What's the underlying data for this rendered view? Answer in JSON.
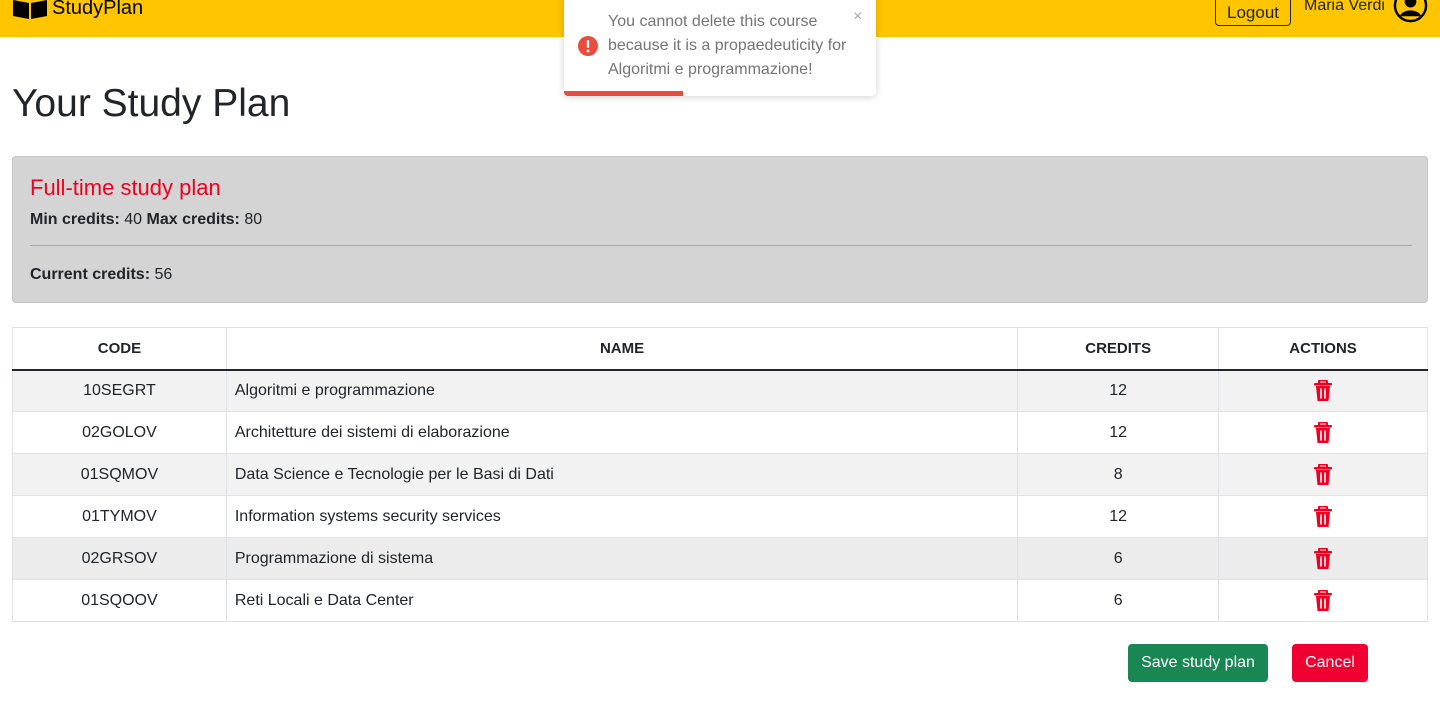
{
  "navbar": {
    "brand": "StudyPlan",
    "logout_label": "Logout",
    "user_name": "Maria Verdi"
  },
  "page": {
    "title": "Your Study Plan"
  },
  "plan": {
    "type_label": "Full-time study plan",
    "min_label": "Min credits:",
    "min_value": "40",
    "max_label": "Max credits:",
    "max_value": "80",
    "current_label": "Current credits:",
    "current_value": "56"
  },
  "table": {
    "headers": [
      "CODE",
      "NAME",
      "CREDITS",
      "ACTIONS"
    ],
    "rows": [
      {
        "code": "10SEGRT",
        "name": "Algoritmi e programmazione",
        "credits": "12"
      },
      {
        "code": "02GOLOV",
        "name": "Architetture dei sistemi di elaborazione",
        "credits": "12"
      },
      {
        "code": "01SQMOV",
        "name": "Data Science e Tecnologie per le Basi di Dati",
        "credits": "8"
      },
      {
        "code": "01TYMOV",
        "name": "Information systems security services",
        "credits": "12"
      },
      {
        "code": "02GRSOV",
        "name": "Programmazione di sistema",
        "credits": "6"
      },
      {
        "code": "01SQOOV",
        "name": "Reti Locali e Data Center",
        "credits": "6"
      }
    ],
    "action_icon": "trash-icon"
  },
  "actions": {
    "save_label": "Save study plan",
    "cancel_label": "Cancel"
  },
  "toast": {
    "message": "You cannot delete this course because it is a propaedeuticity for Algoritmi e programmazione!",
    "close_glyph": "×",
    "icon": "error-icon",
    "progress": 0.38
  },
  "colors": {
    "navbar": "#ffc600",
    "plan_type": "#f00020",
    "save": "#198754",
    "cancel": "#f00030",
    "trash": "#f00020",
    "toast_error": "#e74c3c"
  }
}
